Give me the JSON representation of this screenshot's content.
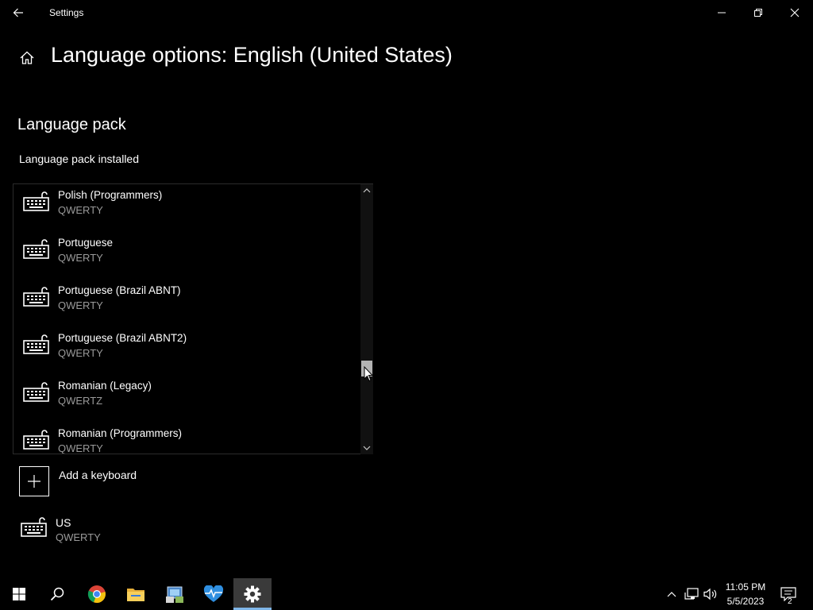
{
  "window": {
    "title": "Settings"
  },
  "header": {
    "title": "Language options: English (United States)"
  },
  "section": {
    "title": "Language pack",
    "status": "Language pack installed"
  },
  "keyboard_list": {
    "items": [
      {
        "name": "Polish (Programmers)",
        "layout": "QWERTY"
      },
      {
        "name": "Portuguese",
        "layout": "QWERTY"
      },
      {
        "name": "Portuguese (Brazil ABNT)",
        "layout": "QWERTY"
      },
      {
        "name": "Portuguese (Brazil ABNT2)",
        "layout": "QWERTY"
      },
      {
        "name": "Romanian (Legacy)",
        "layout": "QWERTZ"
      },
      {
        "name": "Romanian (Programmers)",
        "layout": "QWERTY"
      }
    ]
  },
  "add_keyboard": {
    "label": "Add a keyboard"
  },
  "installed_keyboard": {
    "name": "US",
    "layout": "QWERTY"
  },
  "taskbar": {
    "time": "11:05 PM",
    "date": "5/5/2023",
    "notification_count": "2"
  },
  "colors": {
    "background": "#000000",
    "secondary_text": "#9a9a9a",
    "settings_active": "#3a3a3a"
  }
}
